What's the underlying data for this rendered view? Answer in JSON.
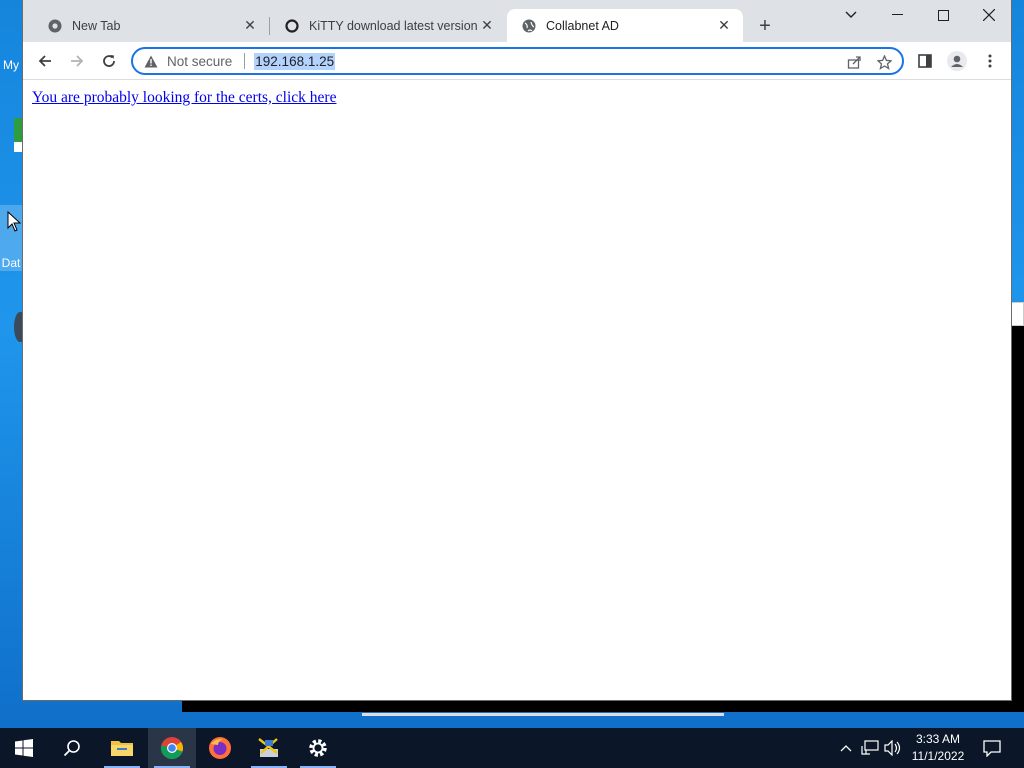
{
  "browser": {
    "tabs": [
      {
        "label": "New Tab",
        "icon": "chrome-icon",
        "active": false
      },
      {
        "label": "KiTTY download latest version",
        "icon": "kitty-site-icon",
        "active": false
      },
      {
        "label": "Collabnet AD",
        "icon": "globe-icon",
        "active": true
      }
    ],
    "address": {
      "security_label": "Not secure",
      "url": "192.168.1.25"
    },
    "page": {
      "link_text": "You are probably looking for the certs, click here"
    }
  },
  "desktop": {
    "labels": [
      "My",
      "Dat"
    ]
  },
  "taskbar": {
    "apps": [
      "start-icon",
      "search-icon",
      "file-explorer-icon",
      "chrome-icon",
      "firefox-icon",
      "network-tool-icon",
      "settings-icon"
    ],
    "clock": {
      "time": "3:33 AM",
      "date": "11/1/2022"
    }
  },
  "colors": {
    "accent": "#1a73e8",
    "link": "#0000ee",
    "tabstrip": "#dee1e6",
    "taskbar": "#0b1628"
  }
}
